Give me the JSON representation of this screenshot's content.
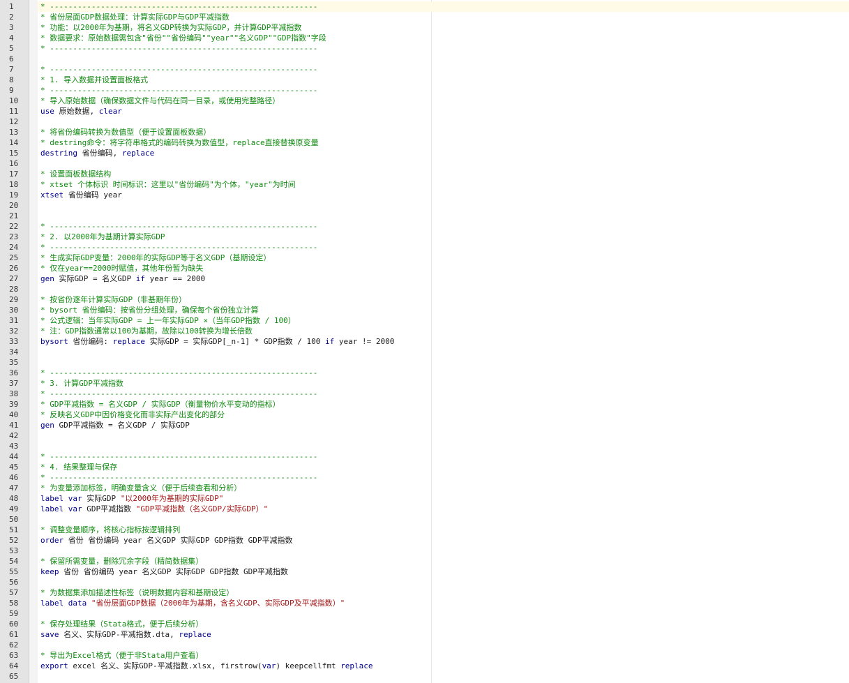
{
  "colors": {
    "comment": "#118a11",
    "keyword": "#00008b",
    "string": "#a31515",
    "text": "#1a1a1a",
    "gutter": "#e4e4e4",
    "current_line": "#fffbe6"
  },
  "lines": [
    {
      "n": "1",
      "segments": [
        {
          "t": "c",
          "v": "* ----------------------------------------------------------"
        }
      ]
    },
    {
      "n": "2",
      "segments": [
        {
          "t": "c",
          "v": "* 省份层面GDP数据处理：计算实际GDP与GDP平减指数"
        }
      ]
    },
    {
      "n": "3",
      "segments": [
        {
          "t": "c",
          "v": "* 功能：以2000年为基期，将名义GDP转换为实际GDP，并计算GDP平减指数"
        }
      ]
    },
    {
      "n": "4",
      "segments": [
        {
          "t": "c",
          "v": "* 数据要求：原始数据需包含\"省份\"\"省份编码\"\"year\"\"名义GDP\"\"GDP指数\"字段"
        }
      ]
    },
    {
      "n": "5",
      "segments": [
        {
          "t": "c",
          "v": "* ----------------------------------------------------------"
        }
      ]
    },
    {
      "n": "6",
      "segments": []
    },
    {
      "n": "7",
      "segments": [
        {
          "t": "c",
          "v": "* ----------------------------------------------------------"
        }
      ]
    },
    {
      "n": "8",
      "segments": [
        {
          "t": "c",
          "v": "* 1. 导入数据并设置面板格式"
        }
      ]
    },
    {
      "n": "9",
      "segments": [
        {
          "t": "c",
          "v": "* ----------------------------------------------------------"
        }
      ]
    },
    {
      "n": "10",
      "segments": [
        {
          "t": "c",
          "v": "* 导入原始数据（确保数据文件与代码在同一目录，或使用完整路径）"
        }
      ]
    },
    {
      "n": "11",
      "segments": [
        {
          "t": "k",
          "v": "use"
        },
        {
          "t": "p",
          "v": " 原始数据, "
        },
        {
          "t": "k",
          "v": "clear"
        }
      ]
    },
    {
      "n": "12",
      "segments": []
    },
    {
      "n": "13",
      "segments": [
        {
          "t": "c",
          "v": "* 将省份编码转换为数值型（便于设置面板数据）"
        }
      ]
    },
    {
      "n": "14",
      "segments": [
        {
          "t": "c",
          "v": "* destring命令：将字符串格式的编码转换为数值型，replace直接替换原变量"
        }
      ]
    },
    {
      "n": "15",
      "segments": [
        {
          "t": "k",
          "v": "destring"
        },
        {
          "t": "p",
          "v": " 省份编码, "
        },
        {
          "t": "k",
          "v": "replace"
        }
      ]
    },
    {
      "n": "16",
      "segments": []
    },
    {
      "n": "17",
      "segments": [
        {
          "t": "c",
          "v": "* 设置面板数据结构"
        }
      ]
    },
    {
      "n": "18",
      "segments": [
        {
          "t": "c",
          "v": "* xtset 个体标识 时间标识：这里以\"省份编码\"为个体，\"year\"为时间"
        }
      ]
    },
    {
      "n": "19",
      "segments": [
        {
          "t": "k",
          "v": "xtset"
        },
        {
          "t": "p",
          "v": " 省份编码 year"
        }
      ]
    },
    {
      "n": "20",
      "segments": []
    },
    {
      "n": "21",
      "segments": []
    },
    {
      "n": "22",
      "segments": [
        {
          "t": "c",
          "v": "* ----------------------------------------------------------"
        }
      ]
    },
    {
      "n": "23",
      "segments": [
        {
          "t": "c",
          "v": "* 2. 以2000年为基期计算实际GDP"
        }
      ]
    },
    {
      "n": "24",
      "segments": [
        {
          "t": "c",
          "v": "* ----------------------------------------------------------"
        }
      ]
    },
    {
      "n": "25",
      "segments": [
        {
          "t": "c",
          "v": "* 生成实际GDP变量：2000年的实际GDP等于名义GDP（基期设定）"
        }
      ]
    },
    {
      "n": "26",
      "segments": [
        {
          "t": "c",
          "v": "* 仅在year==2000时赋值，其他年份暂为缺失"
        }
      ]
    },
    {
      "n": "27",
      "segments": [
        {
          "t": "k",
          "v": "gen"
        },
        {
          "t": "p",
          "v": " 实际GDP = 名义GDP "
        },
        {
          "t": "k",
          "v": "if"
        },
        {
          "t": "p",
          "v": " year == 2000"
        }
      ]
    },
    {
      "n": "28",
      "segments": []
    },
    {
      "n": "29",
      "segments": [
        {
          "t": "c",
          "v": "* 按省份逐年计算实际GDP（非基期年份）"
        }
      ]
    },
    {
      "n": "30",
      "segments": [
        {
          "t": "c",
          "v": "* bysort 省份编码：按省份分组处理，确保每个省份独立计算"
        }
      ]
    },
    {
      "n": "31",
      "segments": [
        {
          "t": "c",
          "v": "* 公式逻辑：当年实际GDP = 上一年实际GDP ×（当年GDP指数 / 100）"
        }
      ]
    },
    {
      "n": "32",
      "segments": [
        {
          "t": "c",
          "v": "* 注：GDP指数通常以100为基期，故除以100转换为增长倍数"
        }
      ]
    },
    {
      "n": "33",
      "segments": [
        {
          "t": "k",
          "v": "bysort"
        },
        {
          "t": "p",
          "v": " 省份编码: "
        },
        {
          "t": "k",
          "v": "replace"
        },
        {
          "t": "p",
          "v": " 实际GDP = 实际GDP[_n-1] * GDP指数 / 100 "
        },
        {
          "t": "k",
          "v": "if"
        },
        {
          "t": "p",
          "v": " year != 2000"
        }
      ]
    },
    {
      "n": "34",
      "segments": []
    },
    {
      "n": "35",
      "segments": []
    },
    {
      "n": "36",
      "segments": [
        {
          "t": "c",
          "v": "* ----------------------------------------------------------"
        }
      ]
    },
    {
      "n": "37",
      "segments": [
        {
          "t": "c",
          "v": "* 3. 计算GDP平减指数"
        }
      ]
    },
    {
      "n": "38",
      "segments": [
        {
          "t": "c",
          "v": "* ----------------------------------------------------------"
        }
      ]
    },
    {
      "n": "39",
      "segments": [
        {
          "t": "c",
          "v": "* GDP平减指数 = 名义GDP / 实际GDP（衡量物价水平变动的指标）"
        }
      ]
    },
    {
      "n": "40",
      "segments": [
        {
          "t": "c",
          "v": "* 反映名义GDP中因价格变化而非实际产出变化的部分"
        }
      ]
    },
    {
      "n": "41",
      "segments": [
        {
          "t": "k",
          "v": "gen"
        },
        {
          "t": "p",
          "v": " GDP平减指数 = 名义GDP / 实际GDP"
        }
      ]
    },
    {
      "n": "42",
      "segments": []
    },
    {
      "n": "43",
      "segments": []
    },
    {
      "n": "44",
      "segments": [
        {
          "t": "c",
          "v": "* ----------------------------------------------------------"
        }
      ]
    },
    {
      "n": "45",
      "segments": [
        {
          "t": "c",
          "v": "* 4. 结果整理与保存"
        }
      ]
    },
    {
      "n": "46",
      "segments": [
        {
          "t": "c",
          "v": "* ----------------------------------------------------------"
        }
      ]
    },
    {
      "n": "47",
      "segments": [
        {
          "t": "c",
          "v": "* 为变量添加标签，明确变量含义（便于后续查看和分析）"
        }
      ]
    },
    {
      "n": "48",
      "segments": [
        {
          "t": "k",
          "v": "label var"
        },
        {
          "t": "p",
          "v": " 实际GDP "
        },
        {
          "t": "s",
          "v": "\"以2000年为基期的实际GDP\""
        }
      ]
    },
    {
      "n": "49",
      "segments": [
        {
          "t": "k",
          "v": "label var"
        },
        {
          "t": "p",
          "v": " GDP平减指数 "
        },
        {
          "t": "s",
          "v": "\"GDP平减指数（名义GDP/实际GDP）\""
        }
      ]
    },
    {
      "n": "50",
      "segments": []
    },
    {
      "n": "51",
      "segments": [
        {
          "t": "c",
          "v": "* 调整变量顺序，将核心指标按逻辑排列"
        }
      ]
    },
    {
      "n": "52",
      "segments": [
        {
          "t": "k",
          "v": "order"
        },
        {
          "t": "p",
          "v": " 省份 省份编码 year 名义GDP 实际GDP GDP指数 GDP平减指数"
        }
      ]
    },
    {
      "n": "53",
      "segments": []
    },
    {
      "n": "54",
      "segments": [
        {
          "t": "c",
          "v": "* 保留所需变量，删除冗余字段（精简数据集）"
        }
      ]
    },
    {
      "n": "55",
      "segments": [
        {
          "t": "k",
          "v": "keep"
        },
        {
          "t": "p",
          "v": " 省份 省份编码 year 名义GDP 实际GDP GDP指数 GDP平减指数"
        }
      ]
    },
    {
      "n": "56",
      "segments": []
    },
    {
      "n": "57",
      "segments": [
        {
          "t": "c",
          "v": "* 为数据集添加描述性标签（说明数据内容和基期设定）"
        }
      ]
    },
    {
      "n": "58",
      "segments": [
        {
          "t": "k",
          "v": "label data"
        },
        {
          "t": "p",
          "v": " "
        },
        {
          "t": "s",
          "v": "\"省份层面GDP数据（2000年为基期，含名义GDP、实际GDP及平减指数）\""
        }
      ]
    },
    {
      "n": "59",
      "segments": []
    },
    {
      "n": "60",
      "segments": [
        {
          "t": "c",
          "v": "* 保存处理结果（Stata格式，便于后续分析）"
        }
      ]
    },
    {
      "n": "61",
      "segments": [
        {
          "t": "k",
          "v": "save"
        },
        {
          "t": "p",
          "v": " 名义、实际GDP-平减指数.dta, "
        },
        {
          "t": "k",
          "v": "replace"
        }
      ]
    },
    {
      "n": "62",
      "segments": []
    },
    {
      "n": "63",
      "segments": [
        {
          "t": "c",
          "v": "* 导出为Excel格式（便于非Stata用户查看）"
        }
      ]
    },
    {
      "n": "64",
      "segments": [
        {
          "t": "k",
          "v": "export"
        },
        {
          "t": "p",
          "v": " excel 名义、实际GDP-平减指数.xlsx, firstrow("
        },
        {
          "t": "k",
          "v": "var"
        },
        {
          "t": "p",
          "v": ") keepcellfmt "
        },
        {
          "t": "k",
          "v": "replace"
        }
      ]
    },
    {
      "n": "65",
      "segments": []
    }
  ]
}
